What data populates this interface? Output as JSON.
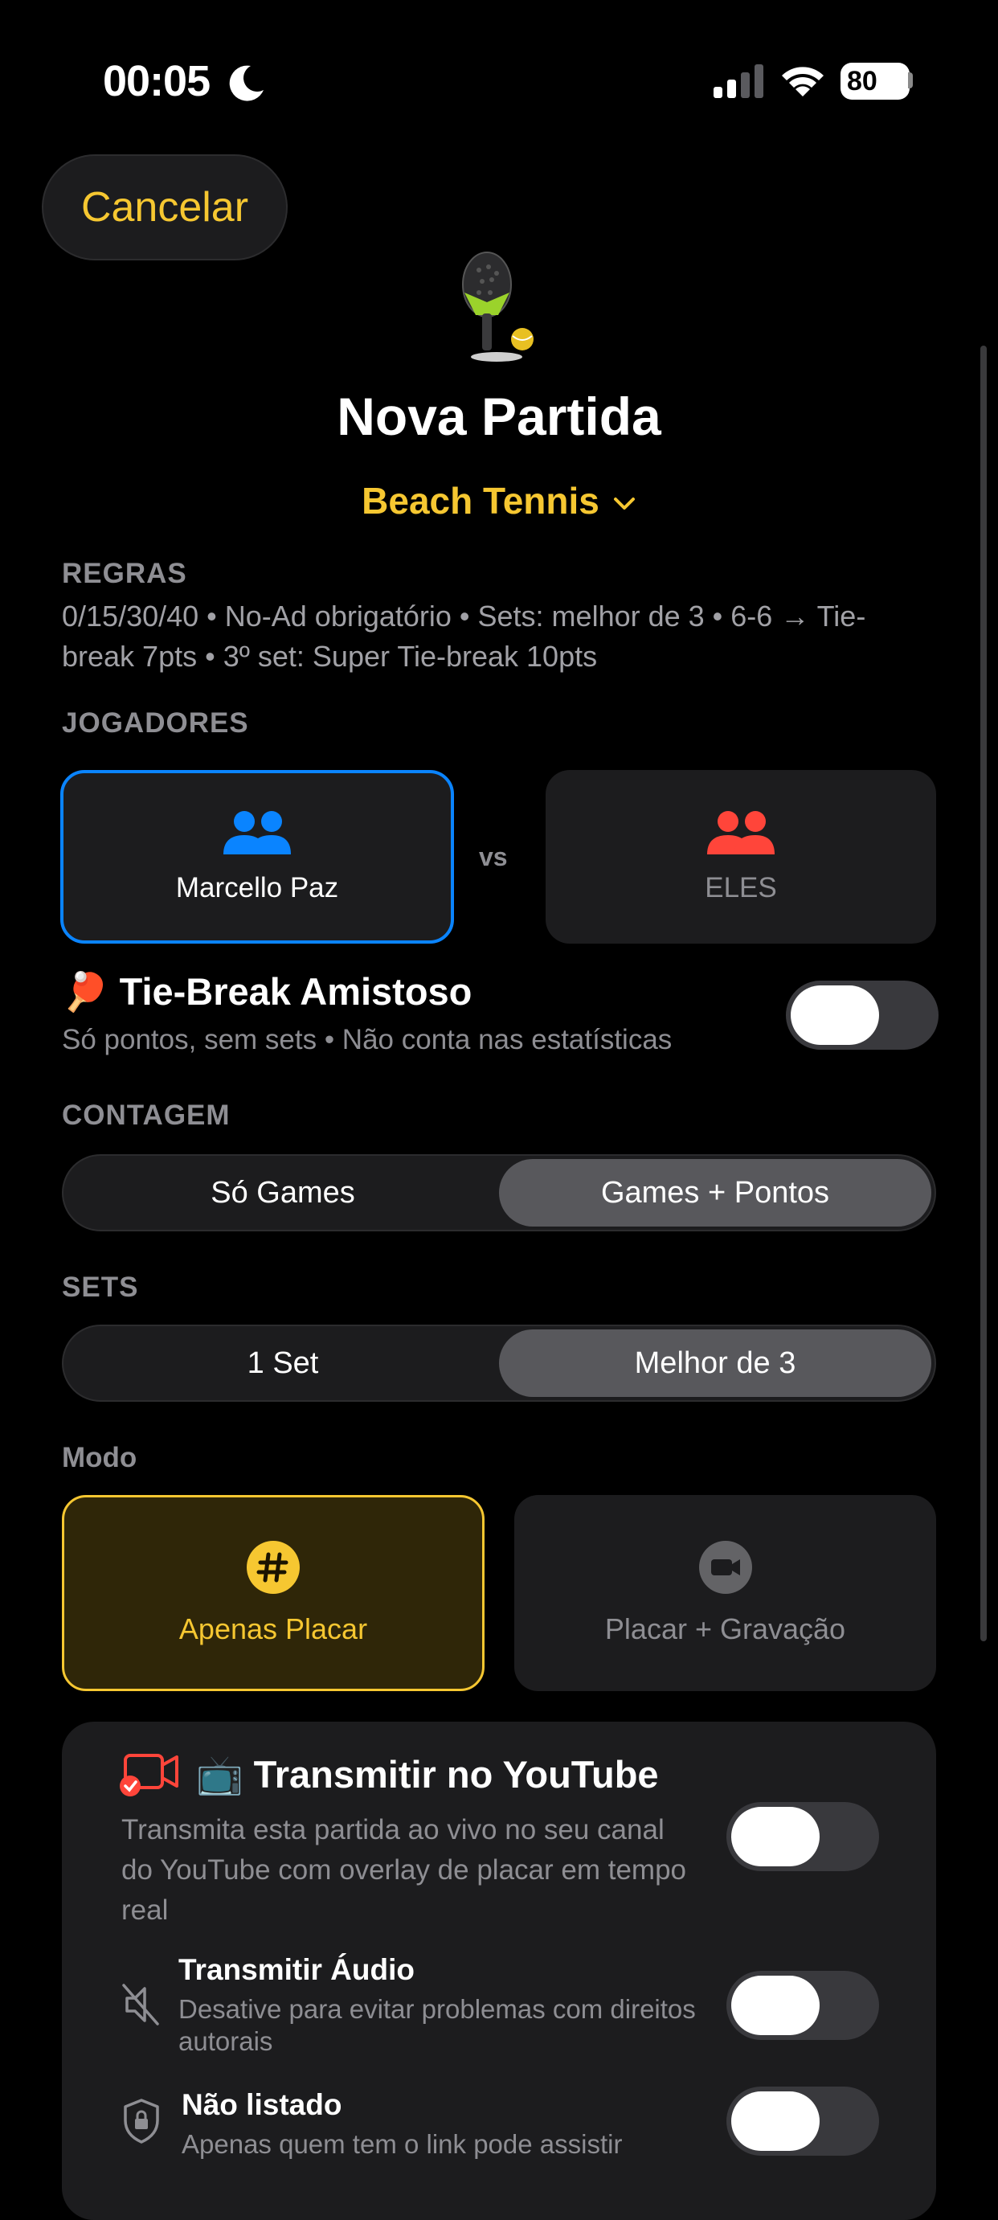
{
  "status_bar": {
    "time": "00:05",
    "battery": "80"
  },
  "nav": {
    "cancel_label": "Cancelar"
  },
  "header": {
    "title": "Nova Partida",
    "sport": "Beach Tennis"
  },
  "rules": {
    "label": "REGRAS",
    "text": "0/15/30/40 • No-Ad obrigatório • Sets: melhor de 3 • 6-6 → Tie-break 7pts • 3º set: Super Tie-break 10pts"
  },
  "players": {
    "label": "JOGADORES",
    "team_a": "Marcello Paz",
    "vs": "vs",
    "team_b": "ELES",
    "colors": {
      "team_a": "#0a84ff",
      "team_b": "#ff453a"
    }
  },
  "tie_break": {
    "title": "🏓 Tie-Break Amistoso",
    "subtitle": "Só pontos, sem sets • Não conta nas estatísticas",
    "enabled": false
  },
  "counting": {
    "label": "CONTAGEM",
    "options": [
      "Só Games",
      "Games + Pontos"
    ],
    "selected": "Games + Pontos"
  },
  "sets": {
    "label": "SETS",
    "options": [
      "1 Set",
      "Melhor de 3"
    ],
    "selected": "Melhor de 3"
  },
  "mode": {
    "label": "Modo",
    "option_a": {
      "label": "Apenas Placar",
      "icon": "hash-icon",
      "selected": true
    },
    "option_b": {
      "label": "Placar + Gravação",
      "icon": "video-camera-icon",
      "selected": false
    },
    "accent": "#f6c731"
  },
  "youtube": {
    "title": "📺 Transmitir no YouTube",
    "description": "Transmita esta partida ao vivo no seu canal do YouTube com overlay de placar em tempo real",
    "enabled": false,
    "audio": {
      "title": "Transmitir Áudio",
      "description": "Desative para evitar problemas com direitos autorais",
      "enabled": false
    },
    "unlisted": {
      "title": "Não listado",
      "description": "Apenas quem tem o link pode assistir",
      "enabled": false
    }
  }
}
